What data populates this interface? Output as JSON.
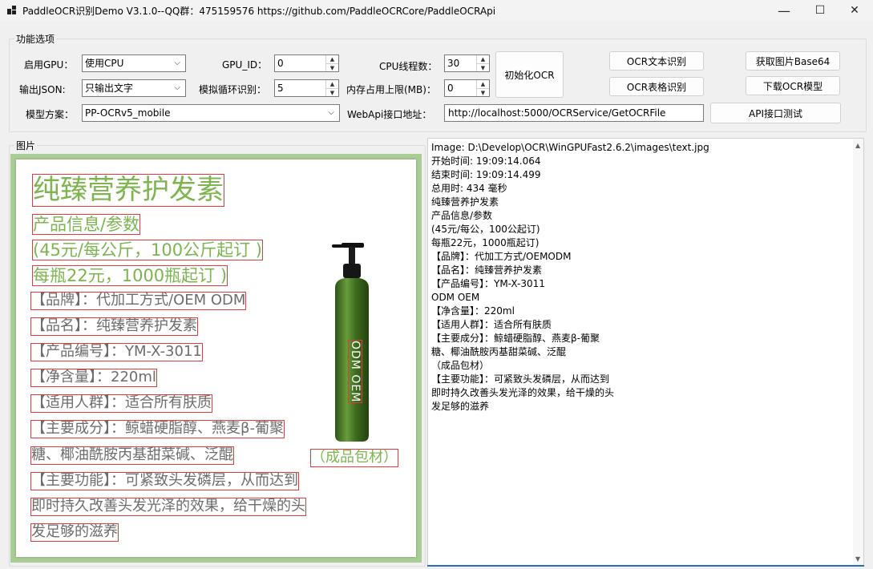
{
  "window": {
    "title": "PaddleOCR识别Demo V3.1.0--QQ群：475159576 https://github.com/PaddleOCRCore/PaddleOCRApi",
    "minimize": "—",
    "maximize": "☐",
    "close": "✕"
  },
  "options": {
    "group_label": "功能选项",
    "gpu_label": "启用GPU：",
    "gpu_value": "使用CPU",
    "json_label": "输出JSON:",
    "json_value": "只输出文字",
    "model_label": "模型方案：",
    "model_value": "PP-OCRv5_mobile",
    "gpu_id_label": "GPU_ID：",
    "gpu_id_value": "0",
    "loop_label": "模拟循环识别：",
    "loop_value": "5",
    "cpu_threads_label": "CPU线程数：",
    "cpu_threads_value": "30",
    "mem_label": "内存占用上限(MB)：",
    "mem_value": "0",
    "webapi_label": "WebApi接口地址：",
    "webapi_value": "http://localhost:5000/OCRService/GetOCRFile",
    "init_button": "初始化OCR",
    "ocr_text_button": "OCR文本识别",
    "ocr_table_button": "OCR表格识别",
    "base64_button": "获取图片Base64",
    "download_button": "下载OCR模型",
    "api_test_button": "API接口测试"
  },
  "image_panel": {
    "group_label": "图片",
    "ocr_boxes": [
      "纯臻营养护发素",
      "产品信息/参数",
      "(45元/每公斤，100公斤起订 )",
      "每瓶22元，1000瓶起订 )",
      "【品牌】：代加工方式/OEM ODM",
      "【品名】：纯臻营养护发素",
      "【产品编号】：YM-X-3011",
      "【净含量】：220ml",
      "【适用人群】：适合所有肤质",
      "【主要成分】：鲸蜡硬脂醇、燕麦β-葡聚",
      "糖、椰油酰胺丙基甜菜碱、泛醌",
      "【主要功能】：可紧致头发磷层，从而达到",
      "即时持久改善头发光泽的效果，给干燥的头",
      "发足够的滋养",
      "（成品包材）",
      "ODM OEM"
    ]
  },
  "result": {
    "lines": [
      "Image: D:\\Develop\\OCR\\WinGPUFast2.6.2\\images\\text.jpg",
      "开始时间: 19:09:14.064",
      "结束时间: 19:09:14.499",
      "总用时: 434 毫秒",
      "纯臻营养护发素",
      "产品信息/参数",
      "(45元/每公，100公起订)",
      "每瓶22元，1000瓶起订)",
      "【品牌】：代加工方式/OEMODM",
      "【品名】：纯臻营养护发素",
      "【产品编号】：YM-X-3011",
      "ODM OEM",
      "【净含量】：220ml",
      "【适用人群】：适合所有肤质",
      "【主要成分】：鲸蜡硬脂醇、燕麦β-葡聚",
      "糖、椰油酰胺丙基甜菜碱、泛醌",
      "（成品包材）",
      "【主要功能】：可紧致头发磷层，从而达到",
      "即时持久改善头发光泽的效果，给干燥的头",
      "发足够的滋养"
    ]
  }
}
